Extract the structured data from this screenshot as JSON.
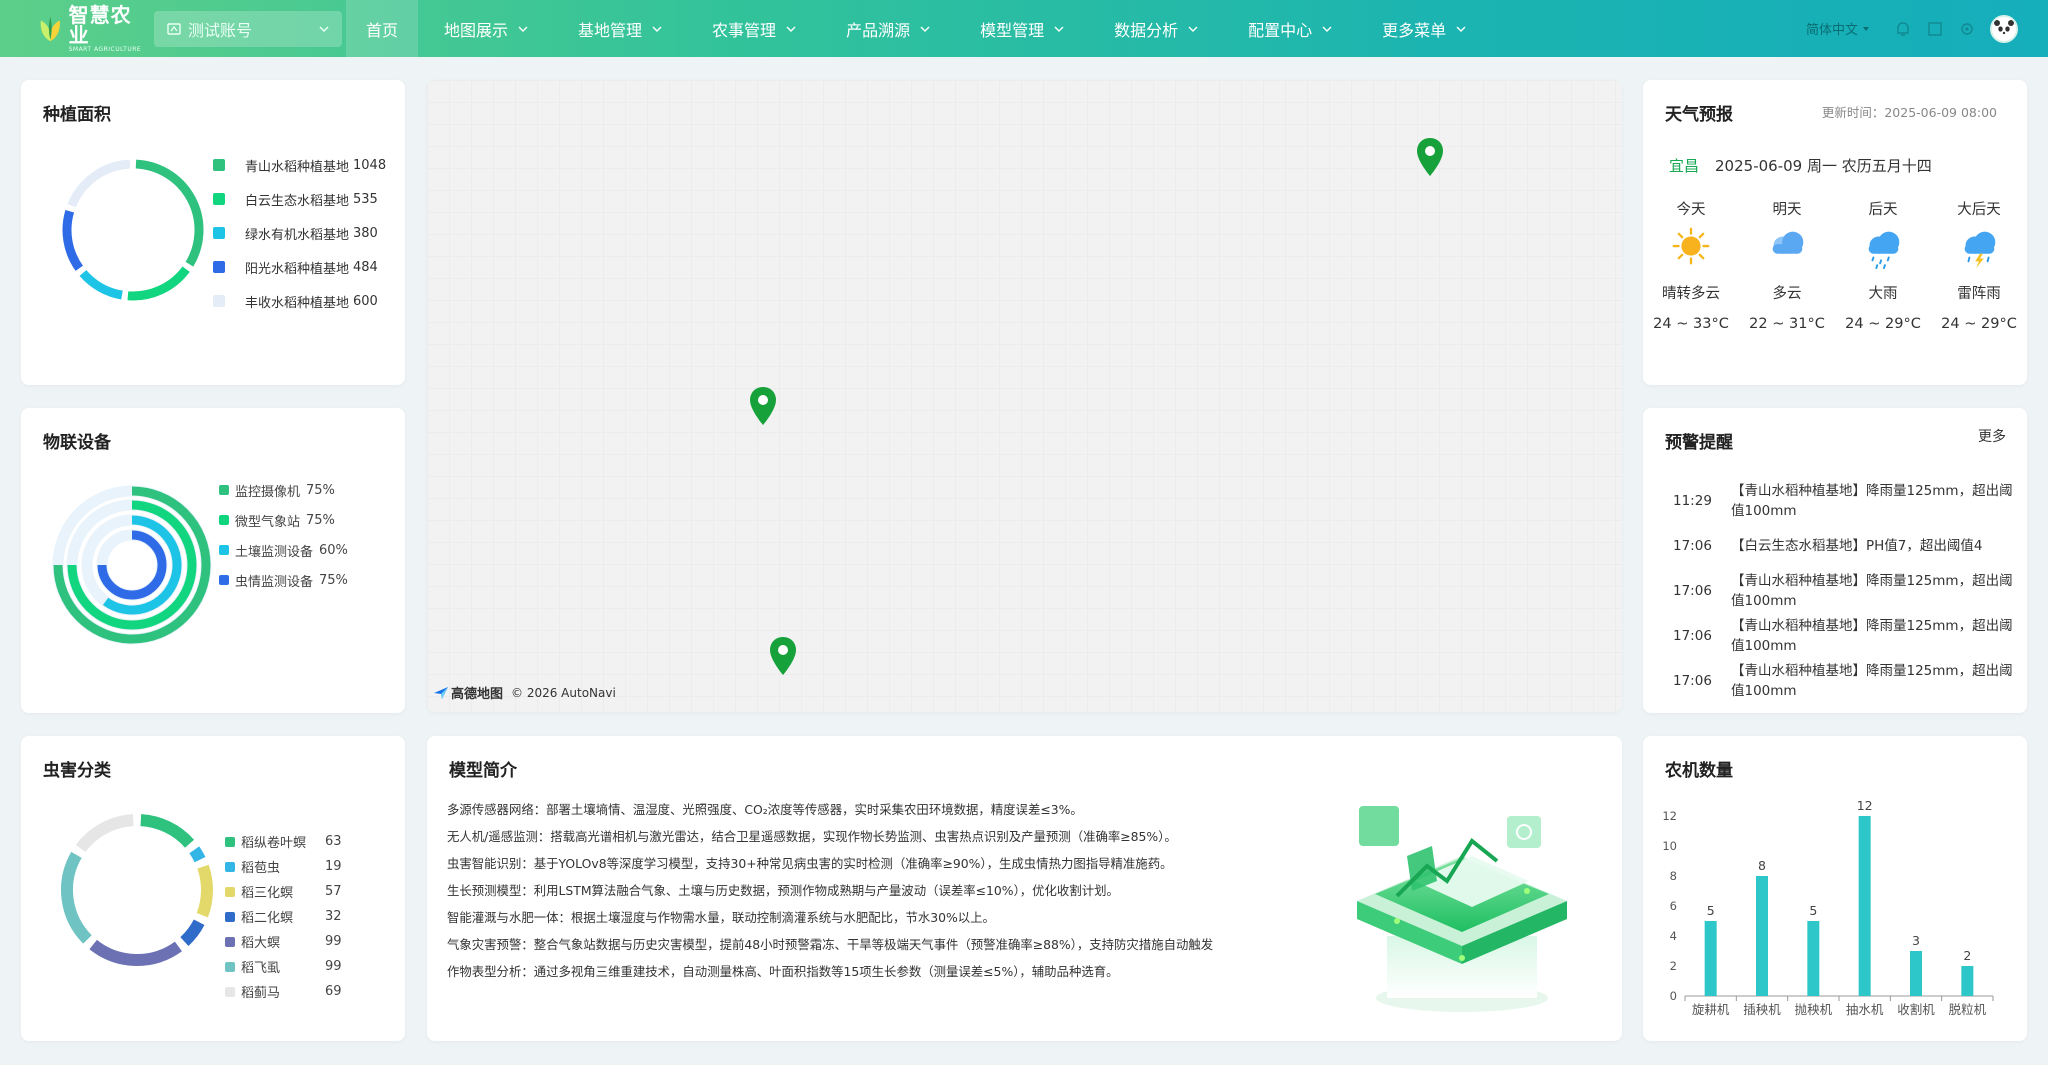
{
  "app": {
    "title": "智慧农业",
    "subtitle": "SMART AGRICULTURE",
    "account": "测试账号"
  },
  "nav": {
    "items": [
      {
        "label": "首页",
        "has_menu": false,
        "active": true
      },
      {
        "label": "地图展示",
        "has_menu": true
      },
      {
        "label": "基地管理",
        "has_menu": true
      },
      {
        "label": "农事管理",
        "has_menu": true
      },
      {
        "label": "产品溯源",
        "has_menu": true
      },
      {
        "label": "模型管理",
        "has_menu": true
      },
      {
        "label": "数据分析",
        "has_menu": true
      },
      {
        "label": "配置中心",
        "has_menu": true
      },
      {
        "label": "更多菜单",
        "has_menu": true
      }
    ],
    "language": "简体中文"
  },
  "planting": {
    "title": "种植面积",
    "items": [
      {
        "name": "青山水稻种植基地",
        "value": "1048",
        "color": "#2ec27e"
      },
      {
        "name": "白云生态水稻基地",
        "value": "535",
        "color": "#11d57f"
      },
      {
        "name": "绿水有机水稻基地",
        "value": "380",
        "color": "#1ec4e6"
      },
      {
        "name": "阳光水稻种植基地",
        "value": "484",
        "color": "#2f6be6"
      },
      {
        "name": "丰收水稻种植基地",
        "value": "600",
        "color": "#e4ecf7"
      }
    ]
  },
  "iot": {
    "title": "物联设备",
    "items": [
      {
        "name": "监控摄像机",
        "pct": "75%",
        "value": 75,
        "color": "#2ec27e"
      },
      {
        "name": "微型气象站",
        "pct": "75%",
        "value": 75,
        "color": "#11d57f"
      },
      {
        "name": "土壤监测设备",
        "pct": "60%",
        "value": 60,
        "color": "#1ec4e6"
      },
      {
        "name": "虫情监测设备",
        "pct": "75%",
        "value": 75,
        "color": "#2f6be6"
      }
    ]
  },
  "pest": {
    "title": "虫害分类",
    "items": [
      {
        "name": "稻纵卷叶螟",
        "value": "63",
        "color": "#2ec27e"
      },
      {
        "name": "稻苞虫",
        "value": "19",
        "color": "#33b5e5"
      },
      {
        "name": "稻三化螟",
        "value": "57",
        "color": "#e3d96a"
      },
      {
        "name": "稻二化螟",
        "value": "32",
        "color": "#2f6bc8"
      },
      {
        "name": "稻大螟",
        "value": "99",
        "color": "#6b71b3"
      },
      {
        "name": "稻飞虱",
        "value": "99",
        "color": "#6fc3c3"
      },
      {
        "name": "稻蓟马",
        "value": "69",
        "color": "#e6e6e6"
      }
    ]
  },
  "map": {
    "credit_brand": "高德地图",
    "credit_text": "© 2026 AutoNavi",
    "pin_color": "#17a13a"
  },
  "model": {
    "title": "模型简介",
    "lines": [
      "多源传感器网络：部署土壤墒情、温湿度、光照强度、CO₂浓度等传感器，实时采集农田环境数据，精度误差≤3%。",
      "无人机/遥感监测：搭载高光谱相机与激光雷达，结合卫星遥感数据，实现作物长势监测、虫害热点识别及产量预测（准确率≥85%）。",
      "虫害智能识别：基于YOLOv8等深度学习模型，支持30+种常见病虫害的实时检测（准确率≥90%），生成虫情热力图指导精准施药。",
      "生长预测模型：利用LSTM算法融合气象、土壤与历史数据，预测作物成熟期与产量波动（误差率≤10%），优化收割计划。",
      "智能灌溉与水肥一体：根据土壤湿度与作物需水量，联动控制滴灌系统与水肥配比，节水30%以上。",
      "气象灾害预警：整合气象站数据与历史灾害模型，提前48小时预警霜冻、干旱等极端天气事件（预警准确率≥88%），支持防灾措施自动触发",
      "作物表型分析：通过多视角三维重建技术，自动测量株高、叶面积指数等15项生长参数（测量误差≤5%），辅助品种选育。"
    ]
  },
  "weather": {
    "title": "天气预报",
    "update_time": "更新时间：2025-06-09 08:00",
    "city": "宜昌",
    "date": "2025-06-09 周一 农历五月十四",
    "days": [
      {
        "label": "今天",
        "icon": "sunny-icon",
        "desc": "晴转多云",
        "temp": "24 ~ 33°C"
      },
      {
        "label": "明天",
        "icon": "cloudy-icon",
        "desc": "多云",
        "temp": "22 ~ 31°C"
      },
      {
        "label": "后天",
        "icon": "heavy-rain-icon",
        "desc": "大雨",
        "temp": "24 ~ 29°C"
      },
      {
        "label": "大后天",
        "icon": "thunderstorm-icon",
        "desc": "雷阵雨",
        "temp": "24 ~ 29°C"
      }
    ]
  },
  "warnings": {
    "title": "预警提醒",
    "more": "更多",
    "items": [
      {
        "time": "11:29",
        "text": "【青山水稻种植基地】降雨量125mm，超出阈值100mm"
      },
      {
        "time": "17:06",
        "text": "【白云生态水稻基地】PH值7，超出阈值4"
      },
      {
        "time": "17:06",
        "text": "【青山水稻种植基地】降雨量125mm，超出阈值100mm"
      },
      {
        "time": "17:06",
        "text": "【青山水稻种植基地】降雨量125mm，超出阈值100mm"
      },
      {
        "time": "17:06",
        "text": "【青山水稻种植基地】降雨量125mm，超出阈值100mm"
      }
    ]
  },
  "machines": {
    "title": "农机数量"
  },
  "chart_data": {
    "type": "bar",
    "title": "",
    "categories": [
      "旋耕机",
      "插秧机",
      "抛秧机",
      "抽水机",
      "收割机",
      "脱粒机"
    ],
    "values": [
      5,
      8,
      5,
      12,
      3,
      2
    ],
    "ylim": [
      0,
      12
    ],
    "yticks": [
      0,
      2,
      4,
      6,
      8,
      10,
      12
    ],
    "color": "#2ec7c9",
    "grid": false
  }
}
